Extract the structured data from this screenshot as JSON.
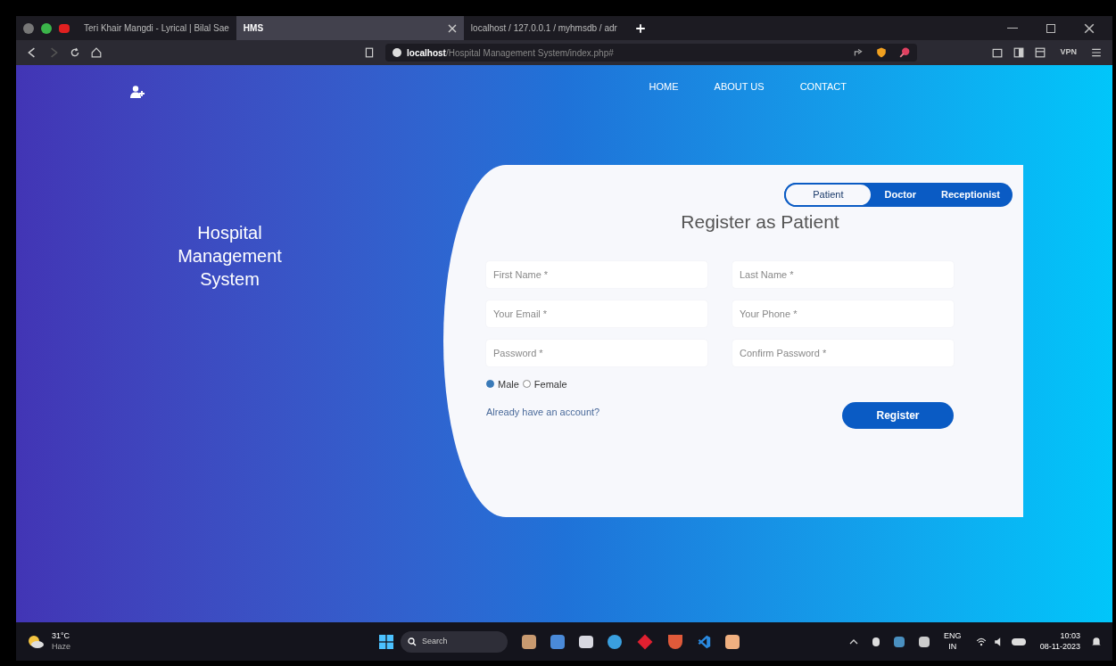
{
  "browser": {
    "tabs": [
      {
        "title": "Teri Khair Mangdi - Lyrical | Bilal Sae",
        "selected": false
      },
      {
        "title": "HMS",
        "selected": true
      },
      {
        "title": "localhost / 127.0.0.1 / myhmsdb / adr",
        "selected": false
      }
    ],
    "address": {
      "host": "localhost",
      "path": "/Hospital Management System/index.php#"
    },
    "vpn": "VPN"
  },
  "nav": {
    "links": [
      "HOME",
      "ABOUT US",
      "CONTACT"
    ]
  },
  "hero": {
    "title": "Hospital Management System"
  },
  "form": {
    "roles": [
      {
        "label": "Patient",
        "selected": true
      },
      {
        "label": "Doctor",
        "selected": false
      },
      {
        "label": "Receptionist",
        "selected": false
      }
    ],
    "heading": "Register as Patient",
    "fields": [
      {
        "placeholder": "First Name *"
      },
      {
        "placeholder": "Last Name *"
      },
      {
        "placeholder": "Your Email *"
      },
      {
        "placeholder": "Your Phone *"
      },
      {
        "placeholder": "Password *"
      },
      {
        "placeholder": "Confirm Password *"
      }
    ],
    "genders": [
      {
        "label": "Male",
        "selected": true
      },
      {
        "label": "Female",
        "selected": false
      }
    ],
    "login_link": "Already have an account?",
    "submit": "Register"
  },
  "taskbar": {
    "weather": {
      "temp": "31°C",
      "condition": "Haze"
    },
    "search": "Search",
    "language": "ENG",
    "region": "IN",
    "time": "10:03",
    "date": "08-11-2023"
  }
}
